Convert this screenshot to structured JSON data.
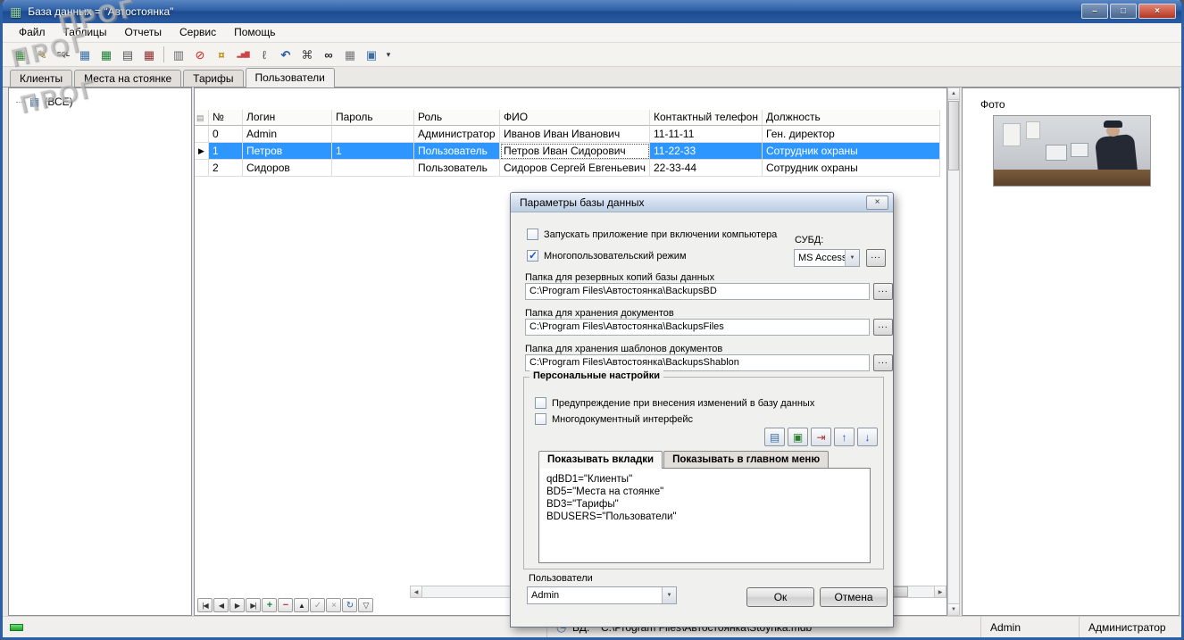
{
  "window": {
    "title": "База данных = \"Автостоянка\"",
    "icon_glyph": "▦",
    "controls": {
      "minimize": "–",
      "maximize": "□",
      "close": "×"
    }
  },
  "watermark": {
    "text": "ПРОГ"
  },
  "menu": {
    "items": [
      {
        "label": "Файл"
      },
      {
        "label": "Таблицы"
      },
      {
        "label": "Отчеты"
      },
      {
        "label": "Сервис"
      },
      {
        "label": "Помощь"
      }
    ]
  },
  "toolbar": {
    "icons": [
      {
        "name": "new-table-icon",
        "glyph": "▦"
      },
      {
        "name": "edit-table-icon",
        "glyph": "✎"
      },
      {
        "name": "sql-query-icon",
        "glyph": "SQL"
      },
      {
        "name": "open-table-icon",
        "glyph": "▦"
      },
      {
        "name": "export-excel-icon",
        "glyph": "▦"
      },
      {
        "name": "print-table-icon",
        "glyph": "▤"
      },
      {
        "name": "delete-table-icon",
        "glyph": "▦"
      },
      {
        "name": "copy-icon",
        "glyph": "▥"
      },
      {
        "name": "clock-icon",
        "glyph": "⊘"
      },
      {
        "name": "payments-icon",
        "glyph": "¤"
      },
      {
        "name": "chart-icon",
        "glyph": "▂▅▇"
      },
      {
        "name": "attachment-icon",
        "glyph": "ℓ"
      },
      {
        "name": "undo-icon",
        "glyph": "↶"
      },
      {
        "name": "structure-icon",
        "glyph": "⌘"
      },
      {
        "name": "search-icon",
        "glyph": "∞"
      },
      {
        "name": "calendar-icon",
        "glyph": "▦"
      },
      {
        "name": "settings-icon",
        "glyph": "▣"
      }
    ],
    "overflow_glyph": "▾"
  },
  "tabs": [
    {
      "label": "Клиенты",
      "active": false
    },
    {
      "label": "Места на стоянке",
      "active": false
    },
    {
      "label": "Тарифы",
      "active": false
    },
    {
      "label": "Пользователи",
      "active": true
    }
  ],
  "tree": {
    "icon_glyph": "▦",
    "root_label": "(ВСЕ)"
  },
  "grid": {
    "marker_header_glyph": "▤",
    "headers": [
      "",
      "№",
      "Логин",
      "Пароль",
      "Роль",
      "ФИО",
      "Контактный телефон",
      "Должность"
    ],
    "rows": [
      {
        "marker": "",
        "selected": false,
        "cells": [
          "0",
          "Admin",
          "",
          "Администратор",
          "Иванов Иван Иванович",
          "11-11-11",
          "Ген. директор"
        ]
      },
      {
        "marker": "▶",
        "selected": true,
        "cells": [
          "1",
          "Петров",
          "1",
          "Пользователь",
          "Петров Иван Сидорович",
          "11-22-33",
          "Сотрудник охраны"
        ]
      },
      {
        "marker": "",
        "selected": false,
        "cells": [
          "2",
          "Сидоров",
          "",
          "Пользователь",
          "Сидоров Сергей Евгеньевич",
          "22-33-44",
          "Сотрудник охраны"
        ]
      }
    ]
  },
  "navigator": {
    "buttons": [
      {
        "name": "first",
        "glyph": "|◀"
      },
      {
        "name": "prior",
        "glyph": "◀"
      },
      {
        "name": "next",
        "glyph": "▶"
      },
      {
        "name": "last",
        "glyph": "▶|"
      },
      {
        "name": "insert",
        "glyph": "+"
      },
      {
        "name": "delete",
        "glyph": "−"
      },
      {
        "name": "edit",
        "glyph": "▲"
      },
      {
        "name": "post",
        "glyph": "✓"
      },
      {
        "name": "cancel",
        "glyph": "×"
      },
      {
        "name": "refresh",
        "glyph": "↻"
      },
      {
        "name": "filter",
        "glyph": "▽"
      }
    ]
  },
  "scrollbars": {
    "up": "▲",
    "down": "▼",
    "left": "◀",
    "right": "▶"
  },
  "photo_panel": {
    "label": "Фото"
  },
  "dialog": {
    "title": "Параметры базы данных",
    "close_glyph": "×",
    "autostart": {
      "label": "Запускать приложение при включении компьютера",
      "checked": false
    },
    "multiuser": {
      "label": "Многопользовательский режим",
      "checked": true
    },
    "dbms": {
      "label": "СУБД:",
      "value": "MS Access",
      "browse": "..."
    },
    "folders": [
      {
        "label": "Папка для резервных копий базы данных",
        "value": "C:\\Program Files\\Автостоянка\\BackupsBD",
        "browse": "..."
      },
      {
        "label": "Папка для хранения документов",
        "value": "C:\\Program Files\\Автостоянка\\BackupsFiles",
        "browse": "..."
      },
      {
        "label": "Папка для хранения шаблонов документов",
        "value": "C:\\Program Files\\Автостоянка\\BackupsShablon",
        "browse": "..."
      }
    ],
    "personal": {
      "title": "Персональные настройки",
      "warn": {
        "label": "Предупреждение при внесения изменений в базу данных",
        "checked": false
      },
      "mdi": {
        "label": "Многодокументный интерфейс",
        "checked": false
      },
      "tool_buttons": [
        {
          "name": "export-settings-icon",
          "glyph": "▤"
        },
        {
          "name": "save-settings-icon",
          "glyph": "▣"
        },
        {
          "name": "apply-settings-icon",
          "glyph": "⇥"
        },
        {
          "name": "move-up-icon",
          "glyph": "↑"
        },
        {
          "name": "move-down-icon",
          "glyph": "↓"
        }
      ],
      "tabs": [
        {
          "label": "Показывать вкладки",
          "active": true
        },
        {
          "label": "Показывать в главном меню",
          "active": false
        }
      ],
      "list_lines": [
        "qdBD1=\"Клиенты\"",
        "BD5=\"Места на стоянке\"",
        "BD3=\"Тарифы\"",
        "BDUSERS=\"Пользователи\""
      ]
    },
    "users": {
      "label": "Пользователи",
      "value": "Admin"
    },
    "buttons": {
      "ok": "Ок",
      "cancel": "Отмена"
    }
  },
  "statusbar": {
    "db_icon_glyph": "◷",
    "db_label": "БД:",
    "db_path": "C:\\Program Files\\Автостоянка\\Stoynka.mdb",
    "user": "Admin",
    "role": "Администратор"
  },
  "colors": {
    "titlebar": "#2d5fa7",
    "selection": "#2e97ff",
    "status_led": "#33cc33",
    "dialog_caption": "#cfdced"
  }
}
